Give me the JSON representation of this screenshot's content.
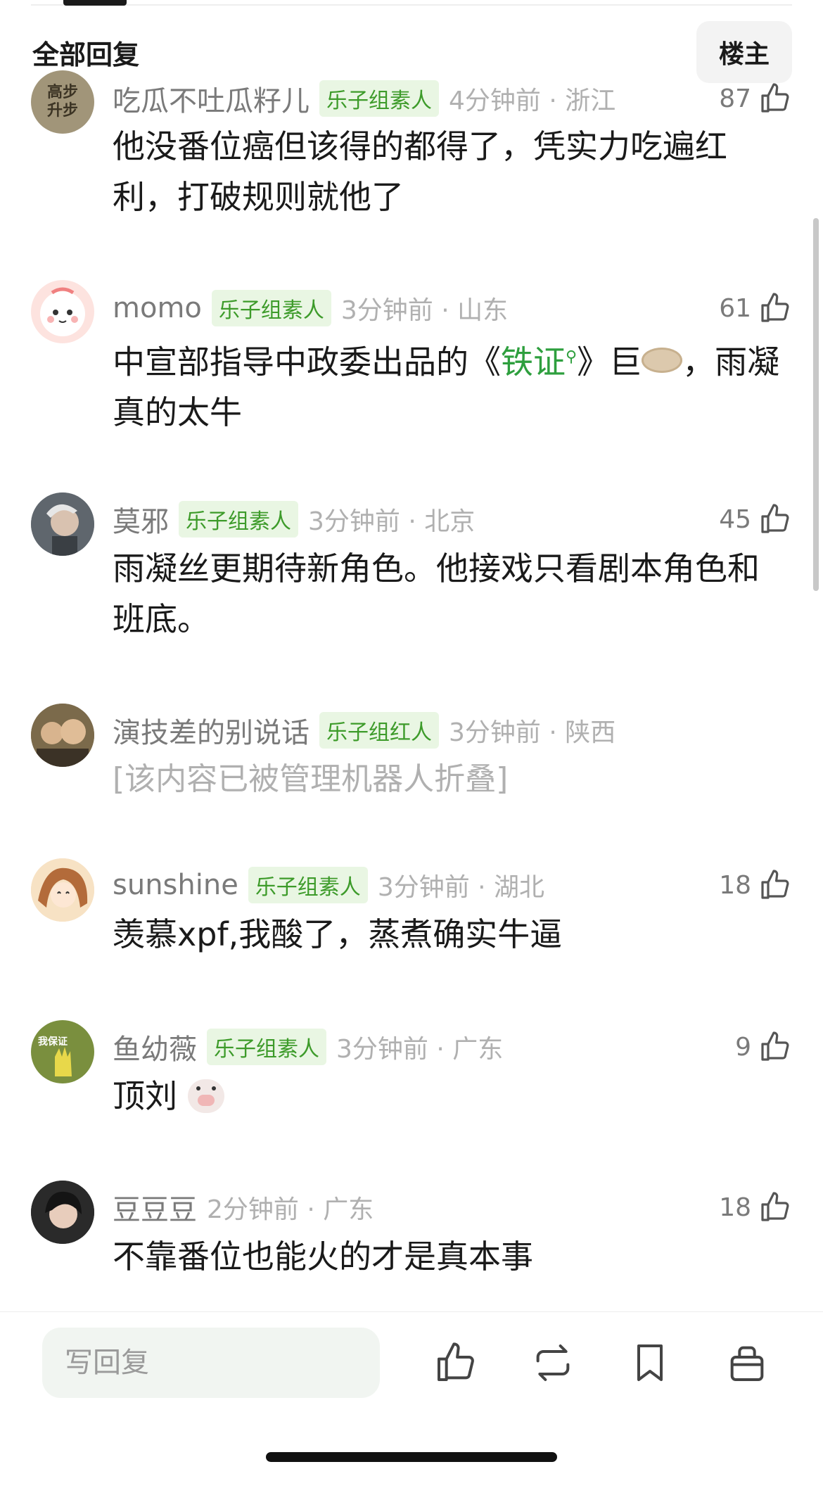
{
  "header": {
    "title": "全部回复",
    "owner_button": "楼主"
  },
  "comments": [
    {
      "avatar_text": "高步\n升步",
      "username": "吃瓜不吐瓜籽儿",
      "badge": "乐子组素人",
      "time": "4分钟前 · 浙江",
      "likes": "87",
      "content": "他没番位癌但该得的都得了，凭实力吃遍红利，打破规则就他了"
    },
    {
      "avatar_text": "",
      "username": "momo",
      "badge": "乐子组素人",
      "time": "3分钟前 · 山东",
      "likes": "61",
      "content_pre": "中宣部指导中政委出品的《",
      "content_link": "铁证",
      "content_post": "》巨",
      "content_tail": "，雨凝真的太牛"
    },
    {
      "avatar_text": "",
      "username": "莫邪",
      "badge": "乐子组素人",
      "time": "3分钟前 · 北京",
      "likes": "45",
      "content": "雨凝丝更期待新角色。他接戏只看剧本角色和班底。"
    },
    {
      "avatar_text": "",
      "username": "演技差的别说话",
      "badge": "乐子组红人",
      "time": "3分钟前 · 陕西",
      "likes": "",
      "content": "[该内容已被管理机器人折叠]"
    },
    {
      "avatar_text": "",
      "username": "sunshine",
      "badge": "乐子组素人",
      "time": "3分钟前 · 湖北",
      "likes": "18",
      "content": "羡慕xpf,我酸了，蒸煮确实牛逼"
    },
    {
      "avatar_text": "我保证",
      "username": "鱼幼薇",
      "badge": "乐子组素人",
      "time": "3分钟前 · 广东",
      "likes": "9",
      "content": "顶刘"
    },
    {
      "avatar_text": "",
      "username": "豆豆豆",
      "badge": "",
      "time": "2分钟前 · 广东",
      "likes": "18",
      "content": "不靠番位也能火的才是真本事"
    }
  ],
  "reply": {
    "placeholder": "写回复"
  },
  "icons": {
    "like": "thumbs-up-icon",
    "repost": "repost-icon",
    "bookmark": "bookmark-icon",
    "gift": "gift-icon",
    "search": "search-icon"
  },
  "colors": {
    "badge_text": "#3d9b2a",
    "badge_bg": "#e9f6e3",
    "link": "#2e9f3e"
  }
}
